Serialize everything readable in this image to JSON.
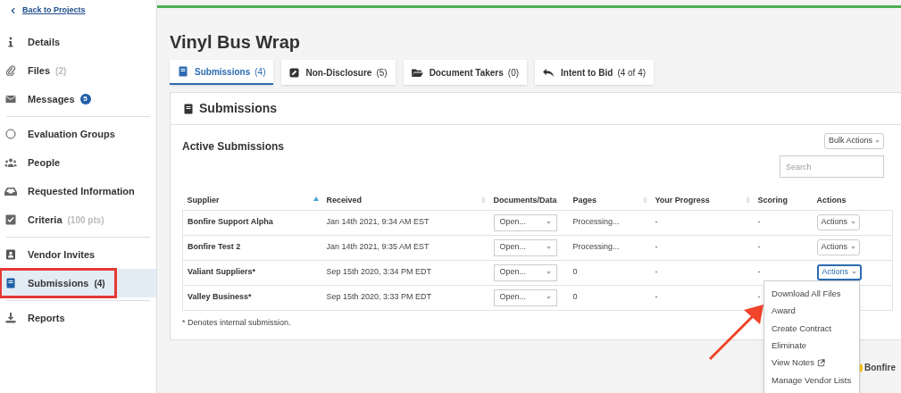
{
  "sidebar": {
    "back_link": "Back to Projects",
    "groups": [
      [
        {
          "kind": "info",
          "label": "Details",
          "selected": false,
          "highlighted": false
        },
        {
          "kind": "clip",
          "label": "Files",
          "count": "(2)",
          "selected": false,
          "highlighted": false
        },
        {
          "kind": "mail",
          "label": "Messages",
          "badge": "5",
          "selected": false,
          "highlighted": false
        }
      ],
      [
        {
          "kind": "circle",
          "label": "Evaluation Groups",
          "selected": false,
          "highlighted": false
        },
        {
          "kind": "people",
          "label": "People",
          "selected": false,
          "highlighted": false
        },
        {
          "kind": "inbox",
          "label": "Requested Information",
          "selected": false,
          "highlighted": false
        },
        {
          "kind": "check",
          "label": "Criteria",
          "count": "(100 pts)",
          "selected": false,
          "highlighted": false
        }
      ],
      [
        {
          "kind": "contact",
          "label": "Vendor Invites",
          "selected": false,
          "highlighted": false
        },
        {
          "kind": "book",
          "label": "Submissions",
          "count": "(4)",
          "selected": true,
          "highlighted": true
        }
      ],
      [
        {
          "kind": "download",
          "label": "Reports",
          "selected": false,
          "highlighted": false
        }
      ]
    ]
  },
  "page": {
    "title": "Vinyl Bus Wrap"
  },
  "tabs": [
    {
      "kind": "book",
      "label": "Submissions",
      "count": "(4)",
      "selected": true
    },
    {
      "kind": "edit",
      "label": "Non-Disclosure",
      "count": "(5)",
      "selected": false
    },
    {
      "kind": "folder",
      "label": "Document Takers",
      "count": "(0)",
      "selected": false
    },
    {
      "kind": "reply",
      "label": "Intent to Bid",
      "count": "(4 of 4)",
      "selected": false
    }
  ],
  "panel": {
    "title": "Submissions",
    "subtitle": "Active Submissions",
    "bulk_actions": "Bulk Actions",
    "search": {
      "placeholder": "Search"
    },
    "table": {
      "columns": [
        {
          "label": "Supplier",
          "sorted": true
        },
        {
          "label": "Received",
          "sorted": false
        },
        {
          "label": "Documents/Data"
        },
        {
          "label": "Pages",
          "sorted": false
        },
        {
          "label": "Your Progress",
          "sorted": false
        },
        {
          "label": "Scoring"
        },
        {
          "label": "Actions"
        }
      ],
      "rows": [
        {
          "supplier": "Bonfire Support Alpha",
          "received": "Jan 14th 2021, 9:34 AM EST",
          "documents": "Open...",
          "pages": "Processing...",
          "progress": "-",
          "scoring": "-",
          "actions": "Actions",
          "open": false
        },
        {
          "supplier": "Bonfire Test 2",
          "received": "Jan 14th 2021, 9:35 AM EST",
          "documents": "Open...",
          "pages": "Processing...",
          "progress": "-",
          "scoring": "-",
          "actions": "Actions",
          "open": false
        },
        {
          "supplier": "Valiant Suppliers*",
          "received": "Sep 15th 2020, 3:34 PM EDT",
          "documents": "Open...",
          "pages": "0",
          "progress": "-",
          "scoring": "-",
          "actions": "Actions",
          "open": true
        },
        {
          "supplier": "Valley Business*",
          "received": "Sep 15th 2020, 3:33 PM EDT",
          "documents": "Open...",
          "pages": "0",
          "progress": "-",
          "scoring": "-"
        }
      ]
    },
    "footnote": "* Denotes internal submission."
  },
  "actions_menu": [
    {
      "label": "Download All Files"
    },
    {
      "label": "Award"
    },
    {
      "label": "Create Contract"
    },
    {
      "label": "Eliminate"
    },
    {
      "label": "View Notes",
      "external": true
    },
    {
      "label": "Manage Vendor Lists"
    }
  ],
  "footer_logo": "Bonfire"
}
